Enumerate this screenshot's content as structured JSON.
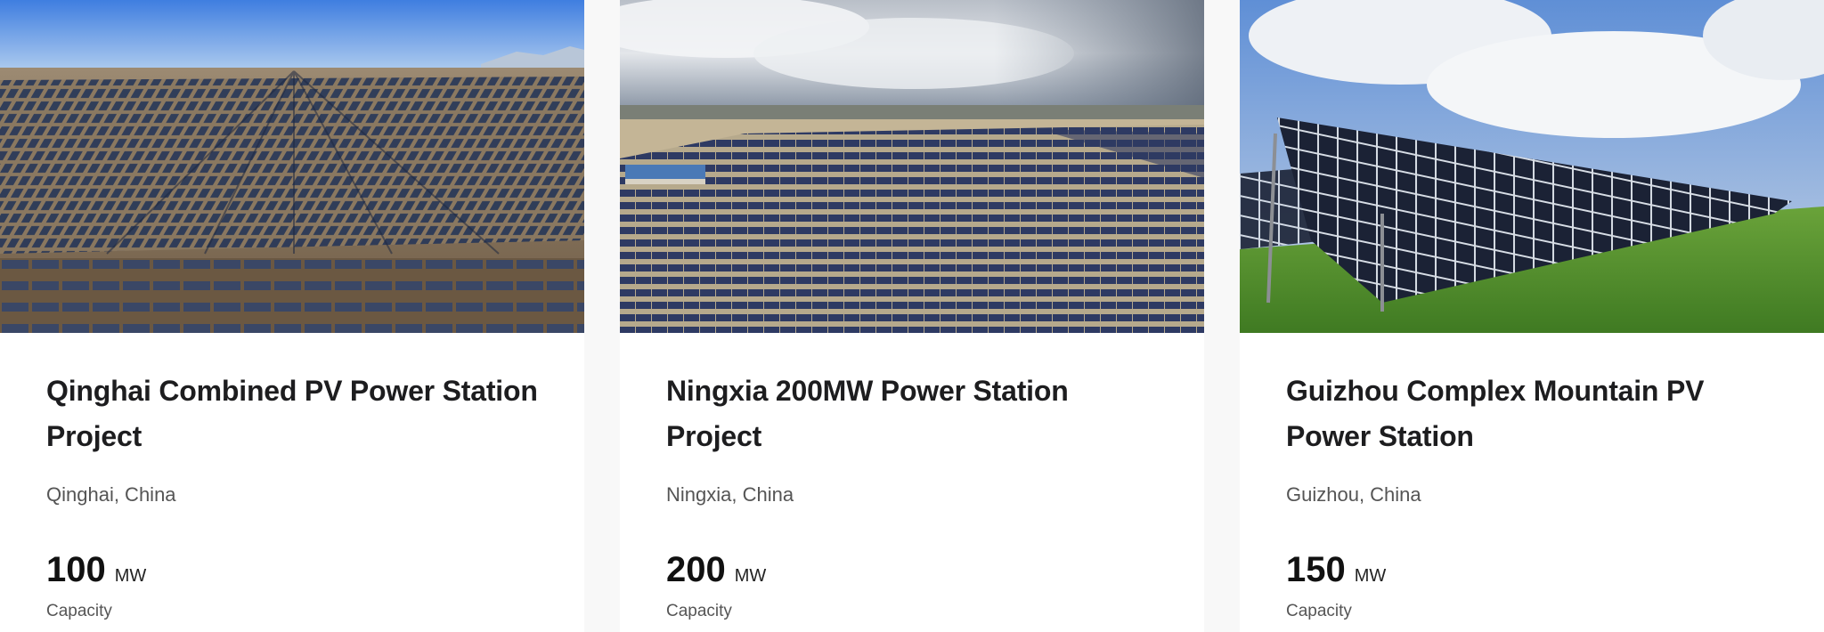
{
  "projects": [
    {
      "title": "Qinghai Combined PV Power Station Project",
      "location": "Qinghai, China",
      "capacity_value": "100",
      "capacity_unit": "MW",
      "capacity_label": "Capacity"
    },
    {
      "title": "Ningxia 200MW Power Station Project",
      "location": "Ningxia, China",
      "capacity_value": "200",
      "capacity_unit": "MW",
      "capacity_label": "Capacity"
    },
    {
      "title": "Guizhou Complex Mountain PV Power Station",
      "location": "Guizhou, China",
      "capacity_value": "150",
      "capacity_unit": "MW",
      "capacity_label": "Capacity"
    }
  ]
}
